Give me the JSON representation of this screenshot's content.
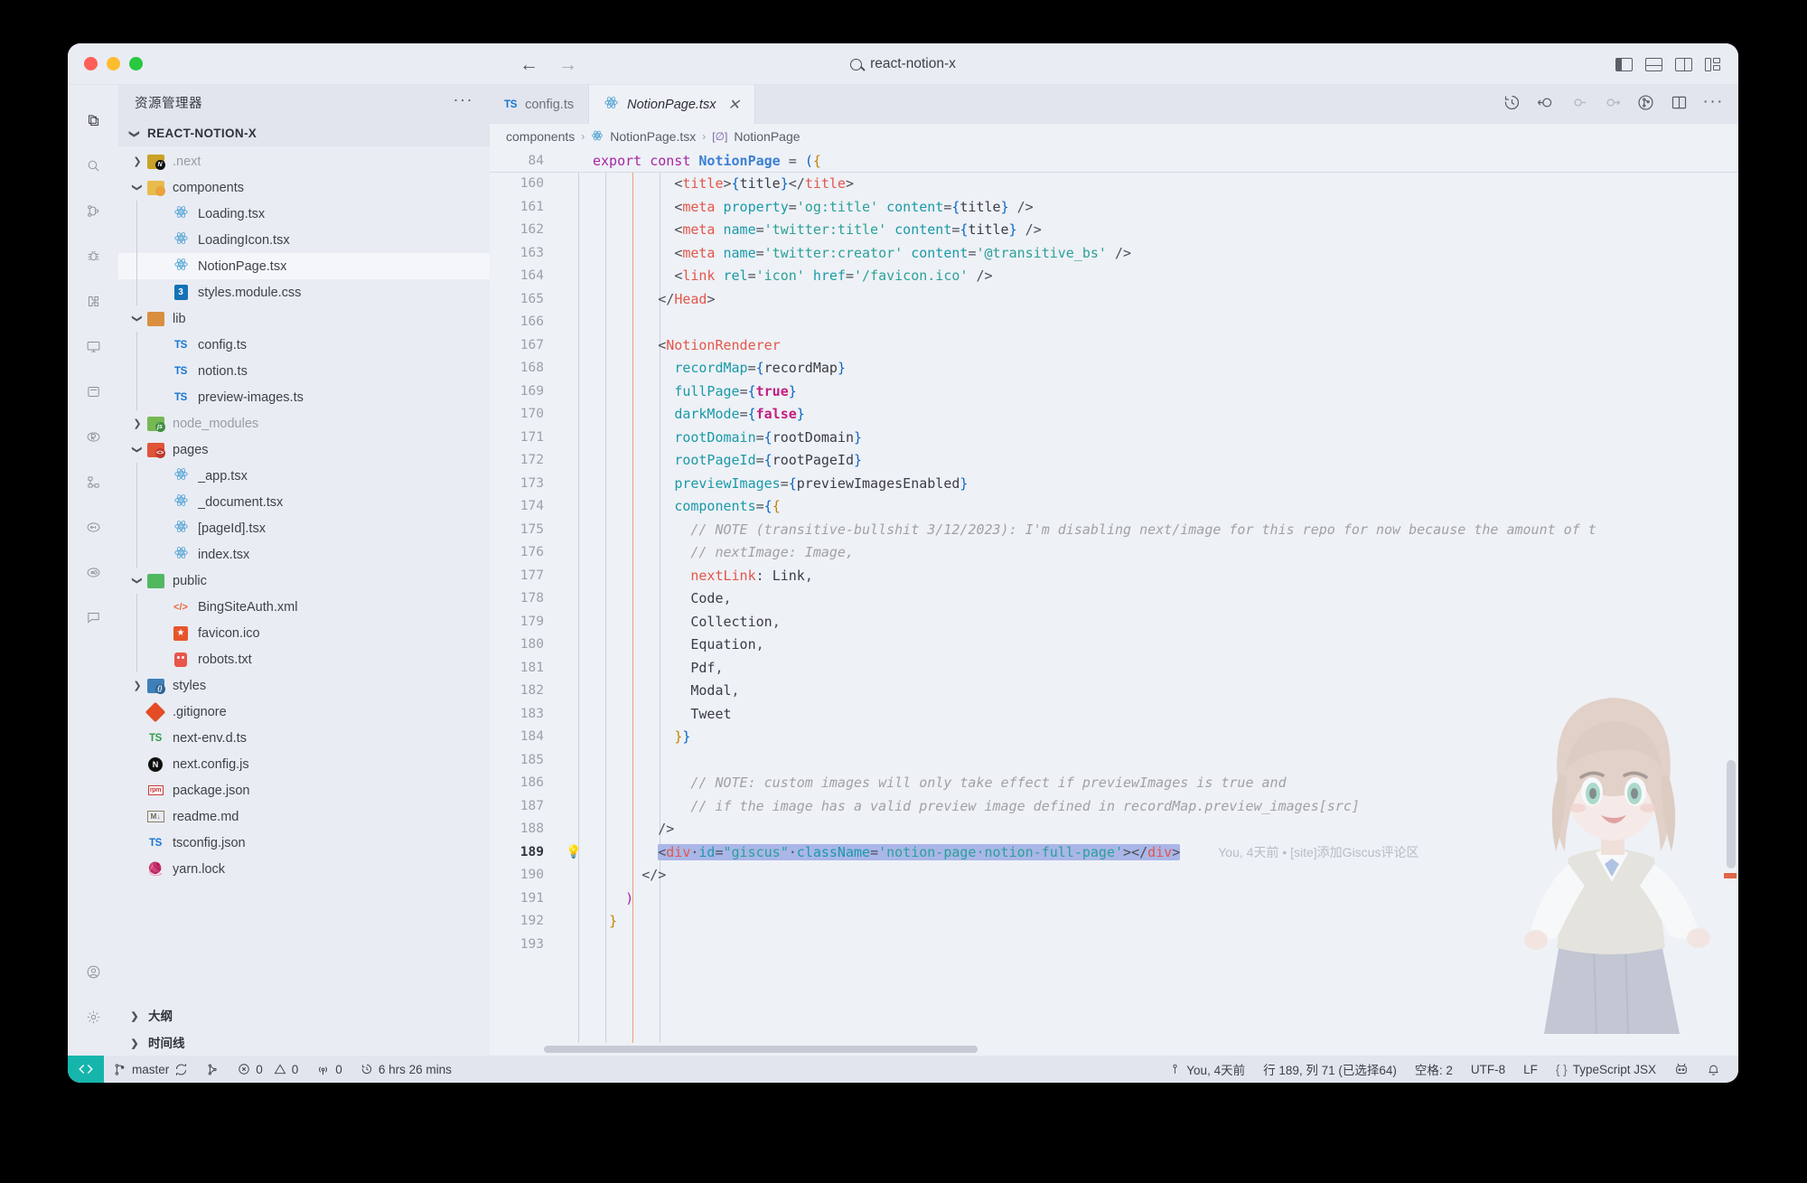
{
  "titlebar": {
    "search_label": "react-notion-x",
    "back_arrow": "←",
    "forward_arrow": "→"
  },
  "sidebar": {
    "header_title": "资源管理器",
    "section_title": "REACT-NOTION-X",
    "tree": [
      {
        "label": ".next",
        "icon": "folder-next",
        "indent": 1,
        "twisty": "right",
        "dim": true
      },
      {
        "label": "components",
        "icon": "folder-comp",
        "indent": 1,
        "twisty": "down",
        "dim": false
      },
      {
        "label": "Loading.tsx",
        "icon": "react",
        "indent": 2,
        "twisty": "",
        "dim": false
      },
      {
        "label": "LoadingIcon.tsx",
        "icon": "react",
        "indent": 2,
        "twisty": "",
        "dim": false
      },
      {
        "label": "NotionPage.tsx",
        "icon": "react",
        "indent": 2,
        "twisty": "",
        "dim": false,
        "selected": true
      },
      {
        "label": "styles.module.css",
        "icon": "css",
        "indent": 2,
        "twisty": "",
        "dim": false
      },
      {
        "label": "lib",
        "icon": "folder-lib",
        "indent": 1,
        "twisty": "down",
        "dim": false
      },
      {
        "label": "config.ts",
        "icon": "ts",
        "indent": 2,
        "twisty": "",
        "dim": false
      },
      {
        "label": "notion.ts",
        "icon": "ts",
        "indent": 2,
        "twisty": "",
        "dim": false
      },
      {
        "label": "preview-images.ts",
        "icon": "ts",
        "indent": 2,
        "twisty": "",
        "dim": false
      },
      {
        "label": "node_modules",
        "icon": "folder-nm",
        "indent": 1,
        "twisty": "right",
        "dim": true
      },
      {
        "label": "pages",
        "icon": "folder-pages",
        "indent": 1,
        "twisty": "down",
        "dim": false
      },
      {
        "label": "_app.tsx",
        "icon": "react",
        "indent": 2,
        "twisty": "",
        "dim": false
      },
      {
        "label": "_document.tsx",
        "icon": "react",
        "indent": 2,
        "twisty": "",
        "dim": false
      },
      {
        "label": "[pageId].tsx",
        "icon": "react",
        "indent": 2,
        "twisty": "",
        "dim": false
      },
      {
        "label": "index.tsx",
        "icon": "react",
        "indent": 2,
        "twisty": "",
        "dim": false
      },
      {
        "label": "public",
        "icon": "folder-public",
        "indent": 1,
        "twisty": "down",
        "dim": false
      },
      {
        "label": "BingSiteAuth.xml",
        "icon": "xml",
        "indent": 2,
        "twisty": "",
        "dim": false
      },
      {
        "label": "favicon.ico",
        "icon": "favicon",
        "indent": 2,
        "twisty": "",
        "dim": false
      },
      {
        "label": "robots.txt",
        "icon": "robot",
        "indent": 2,
        "twisty": "",
        "dim": false
      },
      {
        "label": "styles",
        "icon": "folder-styles",
        "indent": 1,
        "twisty": "right",
        "dim": false
      },
      {
        "label": ".gitignore",
        "icon": "git",
        "indent": 1,
        "twisty": "",
        "dim": false
      },
      {
        "label": "next-env.d.ts",
        "icon": "ts-green",
        "indent": 1,
        "twisty": "",
        "dim": false
      },
      {
        "label": "next.config.js",
        "icon": "nextjs",
        "indent": 1,
        "twisty": "",
        "dim": false
      },
      {
        "label": "package.json",
        "icon": "npm",
        "indent": 1,
        "twisty": "",
        "dim": false
      },
      {
        "label": "readme.md",
        "icon": "md",
        "indent": 1,
        "twisty": "",
        "dim": false
      },
      {
        "label": "tsconfig.json",
        "icon": "ts",
        "indent": 1,
        "twisty": "",
        "dim": false
      },
      {
        "label": "yarn.lock",
        "icon": "yarn",
        "indent": 1,
        "twisty": "",
        "dim": false
      }
    ],
    "panels": [
      {
        "label": "大纲"
      },
      {
        "label": "时间线"
      }
    ]
  },
  "editor": {
    "tabs": [
      {
        "label": "config.ts",
        "icon": "ts",
        "active": false,
        "closable": false
      },
      {
        "label": "NotionPage.tsx",
        "icon": "react",
        "active": true,
        "closable": true
      }
    ],
    "tab_close_glyph": "✕",
    "breadcrumb": [
      "components",
      "NotionPage.tsx",
      "NotionPage"
    ],
    "breadcrumb_separator": "›",
    "sticky_line": {
      "number": "84",
      "text": "export const NotionPage = ({"
    },
    "blame_annotation": "You, 4天前 • [site]添加Giscus评论区",
    "lines": [
      {
        "n": "160",
        "indent": 5,
        "segs": [
          {
            "t": "<",
            "c": "k-punc"
          },
          {
            "t": "title",
            "c": "k-tag"
          },
          {
            "t": ">",
            "c": "k-punc"
          },
          {
            "t": "{",
            "c": "k-brace"
          },
          {
            "t": "title",
            "c": "k-plain"
          },
          {
            "t": "}",
            "c": "k-brace"
          },
          {
            "t": "</",
            "c": "k-punc"
          },
          {
            "t": "title",
            "c": "k-tag"
          },
          {
            "t": ">",
            "c": "k-punc"
          }
        ]
      },
      {
        "n": "161",
        "indent": 5,
        "segs": [
          {
            "t": "<",
            "c": "k-punc"
          },
          {
            "t": "meta",
            "c": "k-tag"
          },
          {
            "t": " ",
            "c": "k-plain"
          },
          {
            "t": "property",
            "c": "k-prop"
          },
          {
            "t": "=",
            "c": "k-punc"
          },
          {
            "t": "'og:title'",
            "c": "k-str"
          },
          {
            "t": " ",
            "c": "k-plain"
          },
          {
            "t": "content",
            "c": "k-prop"
          },
          {
            "t": "=",
            "c": "k-punc"
          },
          {
            "t": "{",
            "c": "k-brace"
          },
          {
            "t": "title",
            "c": "k-plain"
          },
          {
            "t": "}",
            "c": "k-brace"
          },
          {
            "t": " /",
            "c": "k-punc"
          },
          {
            "t": ">",
            "c": "k-punc"
          }
        ]
      },
      {
        "n": "162",
        "indent": 5,
        "segs": [
          {
            "t": "<",
            "c": "k-punc"
          },
          {
            "t": "meta",
            "c": "k-tag"
          },
          {
            "t": " ",
            "c": "k-plain"
          },
          {
            "t": "name",
            "c": "k-prop"
          },
          {
            "t": "=",
            "c": "k-punc"
          },
          {
            "t": "'twitter:title'",
            "c": "k-str"
          },
          {
            "t": " ",
            "c": "k-plain"
          },
          {
            "t": "content",
            "c": "k-prop"
          },
          {
            "t": "=",
            "c": "k-punc"
          },
          {
            "t": "{",
            "c": "k-brace"
          },
          {
            "t": "title",
            "c": "k-plain"
          },
          {
            "t": "}",
            "c": "k-brace"
          },
          {
            "t": " /",
            "c": "k-punc"
          },
          {
            "t": ">",
            "c": "k-punc"
          }
        ]
      },
      {
        "n": "163",
        "indent": 5,
        "segs": [
          {
            "t": "<",
            "c": "k-punc"
          },
          {
            "t": "meta",
            "c": "k-tag"
          },
          {
            "t": " ",
            "c": "k-plain"
          },
          {
            "t": "name",
            "c": "k-prop"
          },
          {
            "t": "=",
            "c": "k-punc"
          },
          {
            "t": "'twitter:creator'",
            "c": "k-str"
          },
          {
            "t": " ",
            "c": "k-plain"
          },
          {
            "t": "content",
            "c": "k-prop"
          },
          {
            "t": "=",
            "c": "k-punc"
          },
          {
            "t": "'@transitive_bs'",
            "c": "k-str"
          },
          {
            "t": " /",
            "c": "k-punc"
          },
          {
            "t": ">",
            "c": "k-punc"
          }
        ]
      },
      {
        "n": "164",
        "indent": 5,
        "segs": [
          {
            "t": "<",
            "c": "k-punc"
          },
          {
            "t": "link",
            "c": "k-tag"
          },
          {
            "t": " ",
            "c": "k-plain"
          },
          {
            "t": "rel",
            "c": "k-prop"
          },
          {
            "t": "=",
            "c": "k-punc"
          },
          {
            "t": "'icon'",
            "c": "k-str"
          },
          {
            "t": " ",
            "c": "k-plain"
          },
          {
            "t": "href",
            "c": "k-prop"
          },
          {
            "t": "=",
            "c": "k-punc"
          },
          {
            "t": "'/favicon.ico'",
            "c": "k-str"
          },
          {
            "t": " /",
            "c": "k-punc"
          },
          {
            "t": ">",
            "c": "k-punc"
          }
        ]
      },
      {
        "n": "165",
        "indent": 4,
        "segs": [
          {
            "t": "</",
            "c": "k-punc"
          },
          {
            "t": "Head",
            "c": "k-tag"
          },
          {
            "t": ">",
            "c": "k-punc"
          }
        ]
      },
      {
        "n": "166",
        "indent": 0,
        "segs": []
      },
      {
        "n": "167",
        "indent": 4,
        "segs": [
          {
            "t": "<",
            "c": "k-punc"
          },
          {
            "t": "NotionRenderer",
            "c": "k-tag"
          }
        ]
      },
      {
        "n": "168",
        "indent": 5,
        "segs": [
          {
            "t": "recordMap",
            "c": "k-prop"
          },
          {
            "t": "=",
            "c": "k-punc"
          },
          {
            "t": "{",
            "c": "k-brace"
          },
          {
            "t": "recordMap",
            "c": "k-plain"
          },
          {
            "t": "}",
            "c": "k-brace"
          }
        ]
      },
      {
        "n": "169",
        "indent": 5,
        "segs": [
          {
            "t": "fullPage",
            "c": "k-prop"
          },
          {
            "t": "=",
            "c": "k-punc"
          },
          {
            "t": "{",
            "c": "k-brace"
          },
          {
            "t": "true",
            "c": "k-bool"
          },
          {
            "t": "}",
            "c": "k-brace"
          }
        ]
      },
      {
        "n": "170",
        "indent": 5,
        "segs": [
          {
            "t": "darkMode",
            "c": "k-prop"
          },
          {
            "t": "=",
            "c": "k-punc"
          },
          {
            "t": "{",
            "c": "k-brace"
          },
          {
            "t": "false",
            "c": "k-bool"
          },
          {
            "t": "}",
            "c": "k-brace"
          }
        ]
      },
      {
        "n": "171",
        "indent": 5,
        "segs": [
          {
            "t": "rootDomain",
            "c": "k-prop"
          },
          {
            "t": "=",
            "c": "k-punc"
          },
          {
            "t": "{",
            "c": "k-brace"
          },
          {
            "t": "rootDomain",
            "c": "k-plain"
          },
          {
            "t": "}",
            "c": "k-brace"
          }
        ]
      },
      {
        "n": "172",
        "indent": 5,
        "segs": [
          {
            "t": "rootPageId",
            "c": "k-prop"
          },
          {
            "t": "=",
            "c": "k-punc"
          },
          {
            "t": "{",
            "c": "k-brace"
          },
          {
            "t": "rootPageId",
            "c": "k-plain"
          },
          {
            "t": "}",
            "c": "k-brace"
          }
        ]
      },
      {
        "n": "173",
        "indent": 5,
        "segs": [
          {
            "t": "previewImages",
            "c": "k-prop"
          },
          {
            "t": "=",
            "c": "k-punc"
          },
          {
            "t": "{",
            "c": "k-brace"
          },
          {
            "t": "previewImagesEnabled",
            "c": "k-plain"
          },
          {
            "t": "}",
            "c": "k-brace"
          }
        ]
      },
      {
        "n": "174",
        "indent": 5,
        "segs": [
          {
            "t": "components",
            "c": "k-prop"
          },
          {
            "t": "=",
            "c": "k-punc"
          },
          {
            "t": "{",
            "c": "k-brace"
          },
          {
            "t": "{",
            "c": "k-brace2"
          }
        ]
      },
      {
        "n": "175",
        "indent": 6,
        "segs": [
          {
            "t": "// NOTE (transitive-bullshit 3/12/2023): I'm disabling next/image for this repo for now because the amount of t",
            "c": "k-cmt"
          }
        ]
      },
      {
        "n": "176",
        "indent": 6,
        "segs": [
          {
            "t": "// nextImage: Image,",
            "c": "k-cmt"
          }
        ]
      },
      {
        "n": "177",
        "indent": 6,
        "segs": [
          {
            "t": "nextLink",
            "c": "k-tag"
          },
          {
            "t": ": ",
            "c": "k-punc"
          },
          {
            "t": "Link",
            "c": "k-plain"
          },
          {
            "t": ",",
            "c": "k-punc"
          }
        ]
      },
      {
        "n": "178",
        "indent": 6,
        "segs": [
          {
            "t": "Code",
            "c": "k-plain"
          },
          {
            "t": ",",
            "c": "k-punc"
          }
        ]
      },
      {
        "n": "179",
        "indent": 6,
        "segs": [
          {
            "t": "Collection",
            "c": "k-plain"
          },
          {
            "t": ",",
            "c": "k-punc"
          }
        ]
      },
      {
        "n": "180",
        "indent": 6,
        "segs": [
          {
            "t": "Equation",
            "c": "k-plain"
          },
          {
            "t": ",",
            "c": "k-punc"
          }
        ]
      },
      {
        "n": "181",
        "indent": 6,
        "segs": [
          {
            "t": "Pdf",
            "c": "k-plain"
          },
          {
            "t": ",",
            "c": "k-punc"
          }
        ]
      },
      {
        "n": "182",
        "indent": 6,
        "segs": [
          {
            "t": "Modal",
            "c": "k-plain"
          },
          {
            "t": ",",
            "c": "k-punc"
          }
        ]
      },
      {
        "n": "183",
        "indent": 6,
        "segs": [
          {
            "t": "Tweet",
            "c": "k-plain"
          }
        ]
      },
      {
        "n": "184",
        "indent": 5,
        "segs": [
          {
            "t": "}",
            "c": "k-brace2"
          },
          {
            "t": "}",
            "c": "k-brace"
          }
        ]
      },
      {
        "n": "185",
        "indent": 0,
        "segs": []
      },
      {
        "n": "186",
        "indent": 6,
        "segs": [
          {
            "t": "// NOTE: custom images will only take effect if previewImages is true and",
            "c": "k-cmt"
          }
        ]
      },
      {
        "n": "187",
        "indent": 6,
        "segs": [
          {
            "t": "// if the image has a valid preview image defined in recordMap.preview_images[src]",
            "c": "k-cmt"
          }
        ]
      },
      {
        "n": "188",
        "indent": 4,
        "segs": [
          {
            "t": "/>",
            "c": "k-punc"
          }
        ]
      },
      {
        "n": "189",
        "indent": 4,
        "selected": true,
        "gutter": "bulb",
        "segs": [
          {
            "t": "<",
            "c": "k-punc"
          },
          {
            "t": "div",
            "c": "k-tag"
          },
          {
            "t": "·",
            "c": "k-punc"
          },
          {
            "t": "id",
            "c": "k-prop"
          },
          {
            "t": "=",
            "c": "k-punc"
          },
          {
            "t": "\"giscus\"",
            "c": "k-str"
          },
          {
            "t": "·",
            "c": "k-punc"
          },
          {
            "t": "className",
            "c": "k-prop"
          },
          {
            "t": "=",
            "c": "k-punc"
          },
          {
            "t": "'notion-page·notion-full-page'",
            "c": "k-str"
          },
          {
            "t": ">",
            "c": "k-punc"
          },
          {
            "t": "</",
            "c": "k-punc"
          },
          {
            "t": "div",
            "c": "k-tag"
          },
          {
            "t": ">",
            "c": "k-punc"
          }
        ]
      },
      {
        "n": "190",
        "indent": 3,
        "segs": [
          {
            "t": "</>",
            "c": "k-punc"
          }
        ]
      },
      {
        "n": "191",
        "indent": 2,
        "segs": [
          {
            "t": ")",
            "c": "k-brace3"
          }
        ]
      },
      {
        "n": "192",
        "indent": 1,
        "segs": [
          {
            "t": "}",
            "c": "k-attr"
          }
        ]
      },
      {
        "n": "193",
        "indent": 0,
        "segs": []
      }
    ]
  },
  "statusbar": {
    "remote_glyph": "❮❯",
    "branch": "master",
    "errors": "0",
    "warnings": "0",
    "ports": "0",
    "timer": "6 hrs 26 mins",
    "blame": "You, 4天前",
    "position": "行 189, 列 71 (已选择64)",
    "indent": "空格: 2",
    "encoding": "UTF-8",
    "eol": "LF",
    "language": "TypeScript JSX"
  },
  "colors": {
    "accent": "#16b5ac",
    "selection": "#aab6e8",
    "window_bg": "#e9ecf3",
    "editor_bg": "#eef1f6"
  }
}
